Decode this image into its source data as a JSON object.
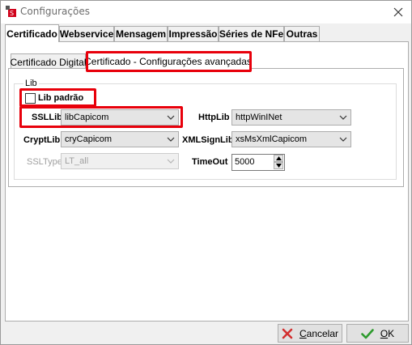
{
  "window": {
    "title": "Configurações"
  },
  "outer_tabs": [
    {
      "label": "Certificado",
      "active": true
    },
    {
      "label": "Webservice"
    },
    {
      "label": "Mensagem"
    },
    {
      "label": "Impressão"
    },
    {
      "label": "Séries de NFe"
    },
    {
      "label": "Outras"
    }
  ],
  "inner_tabs": [
    {
      "label": "Certificado Digital"
    },
    {
      "label": "Certificado - Configurações avançadas",
      "active": true
    }
  ],
  "lib_group": {
    "title": "Lib",
    "lib_padrao": {
      "label": "Lib padrão",
      "checked": false
    },
    "ssllib": {
      "label": "SSLLib",
      "value": "libCapicom"
    },
    "cryptlib": {
      "label": "CryptLib",
      "value": "cryCapicom"
    },
    "ssltype": {
      "label": "SSLType",
      "value": "LT_all",
      "enabled": false
    },
    "httplib": {
      "label": "HttpLib",
      "value": "httpWinINet"
    },
    "xmlsignlib": {
      "label": "XMLSignLib",
      "value": "xsMsXmlCapicom"
    },
    "timeout": {
      "label": "TimeOut",
      "value": "5000"
    }
  },
  "buttons": {
    "cancel": {
      "label_first": "C",
      "label_rest": "ancelar"
    },
    "ok": {
      "label_first": "O",
      "label_rest": "K"
    }
  },
  "colors": {
    "highlight": "#e8000b",
    "cancel_icon": "#d32f2f",
    "ok_icon": "#2e9b2e"
  }
}
